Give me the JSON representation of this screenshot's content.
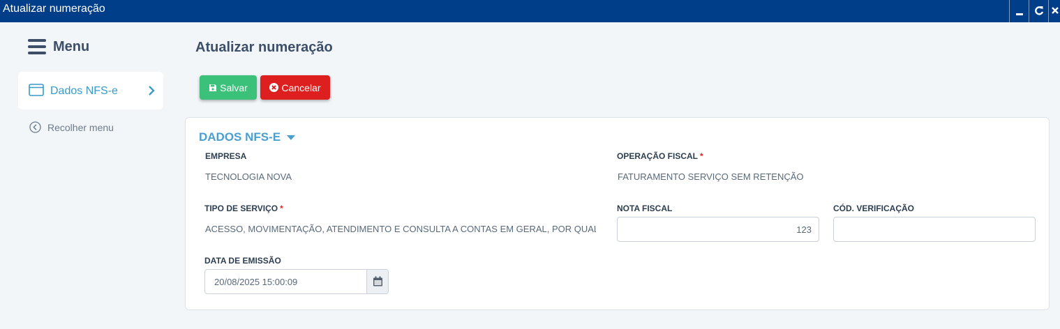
{
  "window": {
    "title": "Atualizar numeração"
  },
  "sidebar": {
    "menu_label": "Menu",
    "items": [
      {
        "label": "Dados NFS-e",
        "icon": "window-icon",
        "active": true
      }
    ],
    "collapse_label": "Recolher menu"
  },
  "page": {
    "title": "Atualizar numeração"
  },
  "toolbar": {
    "save_label": "Salvar",
    "cancel_label": "Cancelar",
    "save_color": "#3cc17a",
    "cancel_color": "#de1f1f"
  },
  "section": {
    "title": "DADOS NFS-E",
    "fields": {
      "empresa": {
        "label": "EMPRESA",
        "value": "TECNOLOGIA NOVA"
      },
      "operacao_fiscal": {
        "label": "OPERAÇÃO FISCAL",
        "required_mark": "*",
        "value": "FATURAMENTO SERVIÇO SEM RETENÇÃO"
      },
      "tipo_servico": {
        "label": "TIPO DE SERVIÇO",
        "required_mark": "*",
        "value": "ACESSO, MOVIMENTAÇÃO, ATENDIMENTO E CONSULTA A CONTAS EM GERAL, POR QUAL"
      },
      "nota_fiscal": {
        "label": "NOTA FISCAL",
        "value": "123"
      },
      "cod_verificacao": {
        "label": "CÓD. VERIFICAÇÃO",
        "value": ""
      },
      "data_emissao": {
        "label": "DATA DE EMISSÃO",
        "value": "20/08/2025 15:00:09"
      }
    }
  },
  "colors": {
    "titlebar": "#003e8a",
    "accent": "#4a9fd0"
  }
}
